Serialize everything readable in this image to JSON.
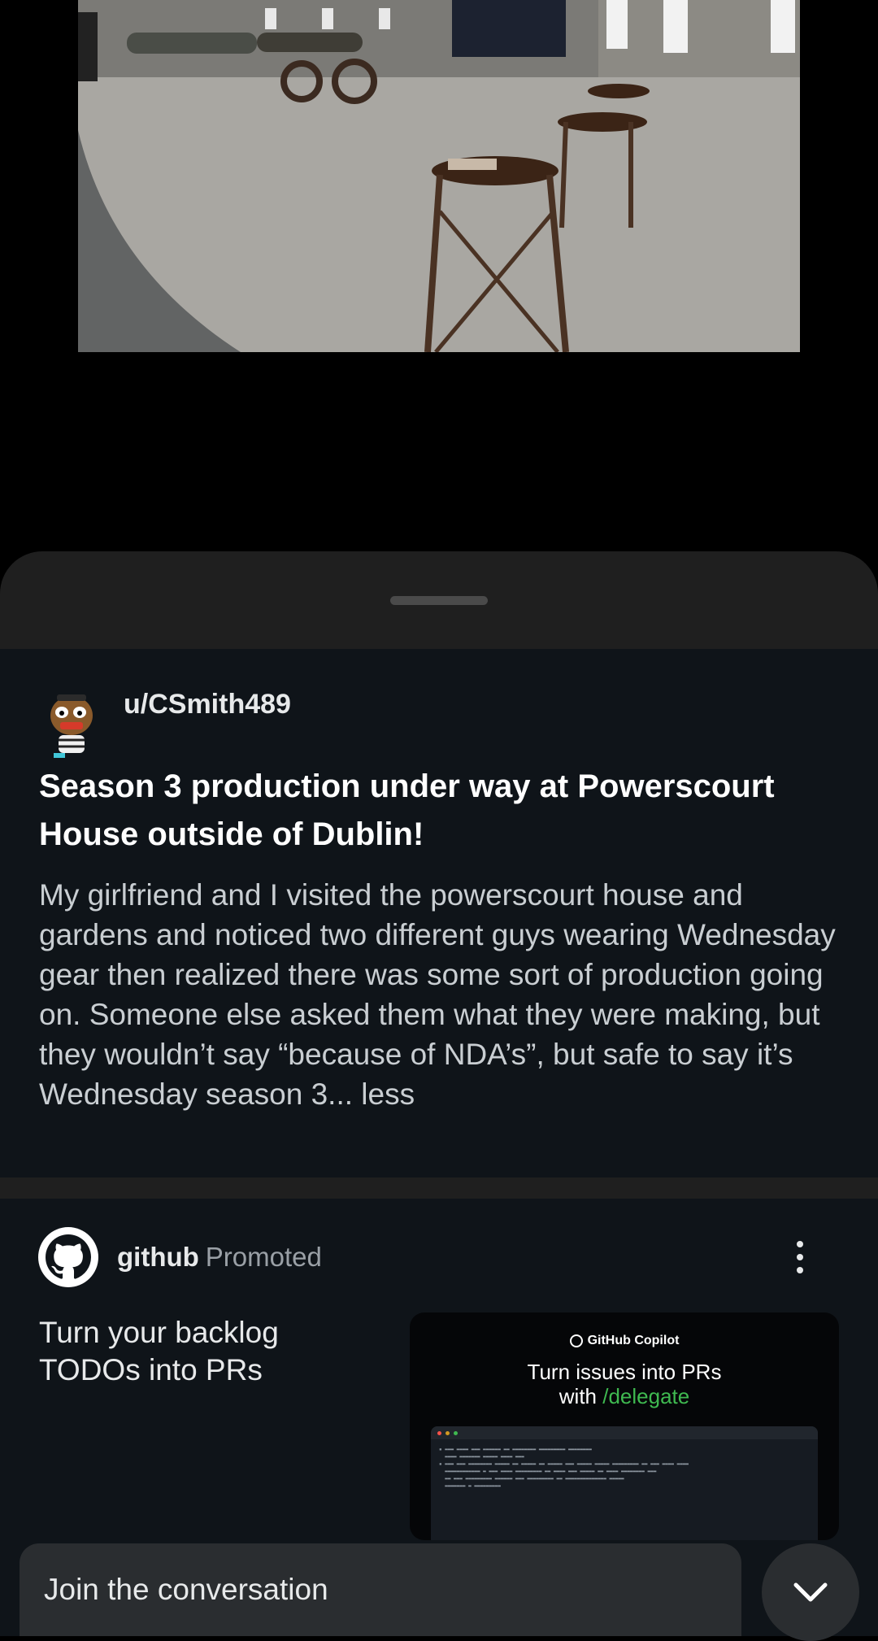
{
  "photo": {
    "alt_icon": "photo"
  },
  "post": {
    "username": "u/CSmith489",
    "title": "Season 3 production under way at Powerscourt House outside of Dublin!",
    "body": "My girlfriend and I visited the powerscourt house and gardens and noticed two different guys wearing Wednesday gear then realized there was some sort of production going on. Someone else asked them what they were making, but they wouldn’t say “because of NDA’s”, but safe to say it’s Wednesday season 3...",
    "less_label": "less"
  },
  "ad": {
    "name": "github",
    "promoted_label": "Promoted",
    "headline": "Turn your backlog TODOs into PRs",
    "card": {
      "brand": "GitHub Copilot",
      "title_line1": "Turn issues into PRs",
      "title_with": "with ",
      "title_command": "/delegate"
    }
  },
  "chat": {
    "placeholder": "Join the conversation"
  },
  "colors": {
    "sheet_bg": "#1f1f1f",
    "post_bg": "#0f1419",
    "accent_green": "#3fb950"
  },
  "icons": [
    "avatar",
    "github-logo",
    "more-vertical-icon",
    "chevron-down-icon"
  ]
}
